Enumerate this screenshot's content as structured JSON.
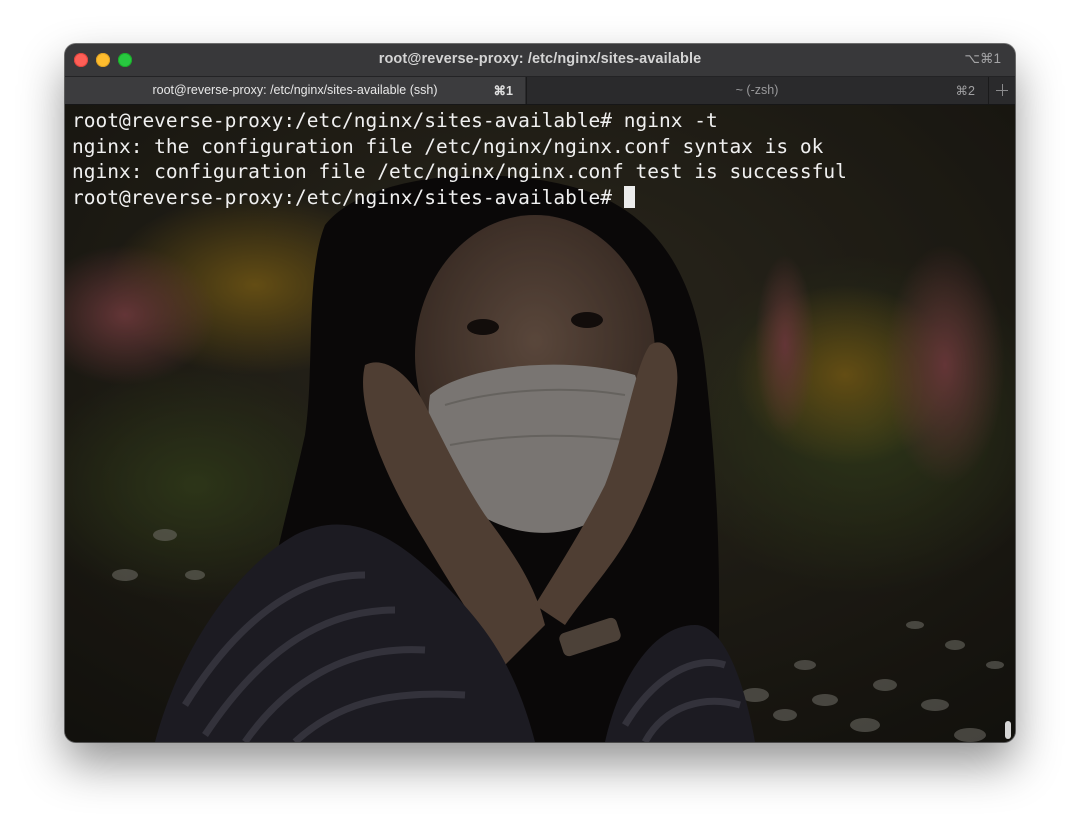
{
  "window": {
    "title": "root@reverse-proxy: /etc/nginx/sites-available",
    "shortcut": "⌥⌘1"
  },
  "tabs": [
    {
      "label": "root@reverse-proxy: /etc/nginx/sites-available (ssh)",
      "shortcut": "⌘1",
      "active": true
    },
    {
      "label": "~ (-zsh)",
      "shortcut": "⌘2",
      "active": false
    }
  ],
  "terminal": {
    "lines": [
      "root@reverse-proxy:/etc/nginx/sites-available# nginx -t",
      "nginx: the configuration file /etc/nginx/nginx.conf syntax is ok",
      "nginx: configuration file /etc/nginx/nginx.conf test is successful",
      "root@reverse-proxy:/etc/nginx/sites-available#"
    ]
  },
  "colors": {
    "close": "#fe5f57",
    "minimize": "#febc2e",
    "maximize": "#28c840",
    "text": "#f0f0f0"
  }
}
